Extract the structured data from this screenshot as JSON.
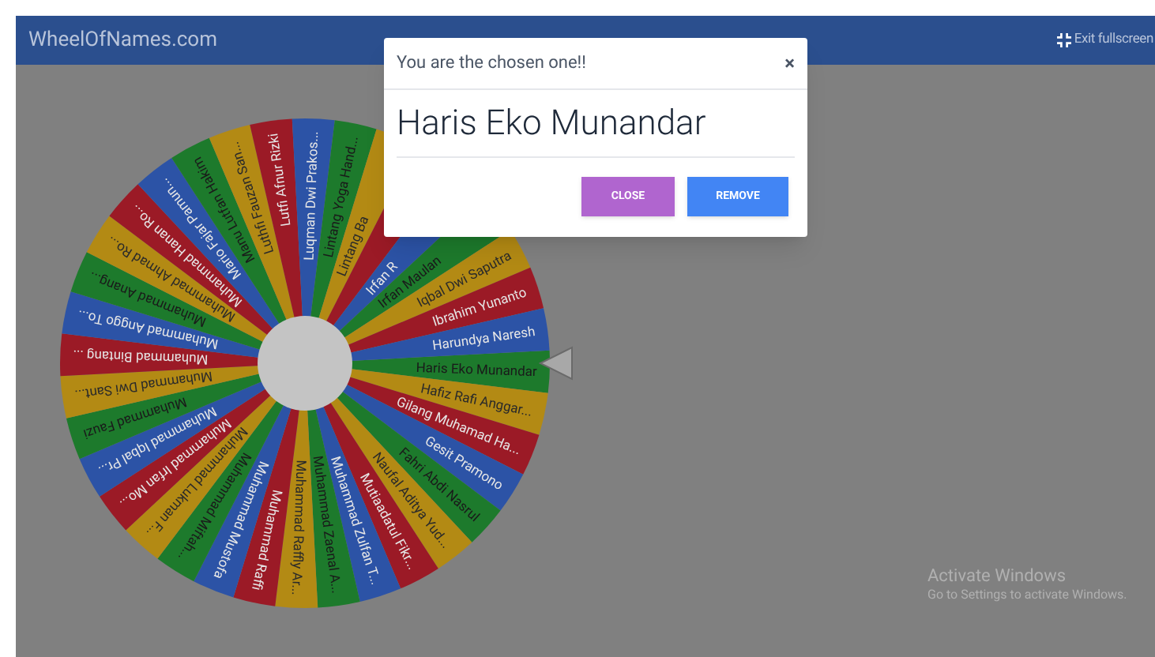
{
  "header": {
    "title": "WheelOfNames.com",
    "fullscreen_link": "Exit fullscreen"
  },
  "wheel": {
    "slices": [
      {
        "label": "Haris Eko Munandar"
      },
      {
        "label": "Hafiz Rafi Anggar..."
      },
      {
        "label": "Gilang Muhamad Ha..."
      },
      {
        "label": "Gesit Pramono"
      },
      {
        "label": "Fahri Abdi Nasrul"
      },
      {
        "label": "Naufal Aditya Yud..."
      },
      {
        "label": "Mutiaadatul Fikr..."
      },
      {
        "label": "Muhammad Zulfan T..."
      },
      {
        "label": "Muhammad Zaenal A..."
      },
      {
        "label": "Muhammad Raffly Ar..."
      },
      {
        "label": "Muhammad Raffi"
      },
      {
        "label": "Muhammad Mustofa"
      },
      {
        "label": "Muhammad Miftah..."
      },
      {
        "label": "Muhammad Lukman F..."
      },
      {
        "label": "Muhammad Irfan Mo..."
      },
      {
        "label": "Muhammad Iqbal Pr..."
      },
      {
        "label": "Muhammad Fauzi"
      },
      {
        "label": "Muhammad Dwi Sant..."
      },
      {
        "label": "Muhammad Bintang ..."
      },
      {
        "label": "Muhammad Anggo To..."
      },
      {
        "label": "Muhammad Anang..."
      },
      {
        "label": "Muhammad Ahmad Ro..."
      },
      {
        "label": "Muhammad Hanan Ro..."
      },
      {
        "label": "Mario Fajar Pamun..."
      },
      {
        "label": "Manu Lutfan Hakim"
      },
      {
        "label": "Luthfi Fauzan San..."
      },
      {
        "label": "Lutfi Afnur Rizki"
      },
      {
        "label": "Luqman Dwi Prakos..."
      },
      {
        "label": "Lintang Yoga Hand..."
      },
      {
        "label": "Lintang Ba",
        "kind": "covered"
      },
      {
        "kind": "blank"
      },
      {
        "label": "Irfan R",
        "kind": "covered"
      },
      {
        "label": "Irfan Maulan",
        "kind": "covered"
      },
      {
        "label": "Iqbal Dwi Saputra"
      },
      {
        "label": "Ibrahim Yunanto"
      },
      {
        "label": "Harundya Naresh"
      }
    ]
  },
  "dialog": {
    "title": "You are the chosen one!!",
    "close_icon": "×",
    "winner": "Haris Eko Munandar",
    "buttons": [
      {
        "label": "CLOSE",
        "kind": "close"
      },
      {
        "label": "REMOVE",
        "kind": "remove"
      }
    ]
  },
  "os_notice": {
    "title": "Activate Windows",
    "message": "Go to Settings to activate Windows."
  }
}
